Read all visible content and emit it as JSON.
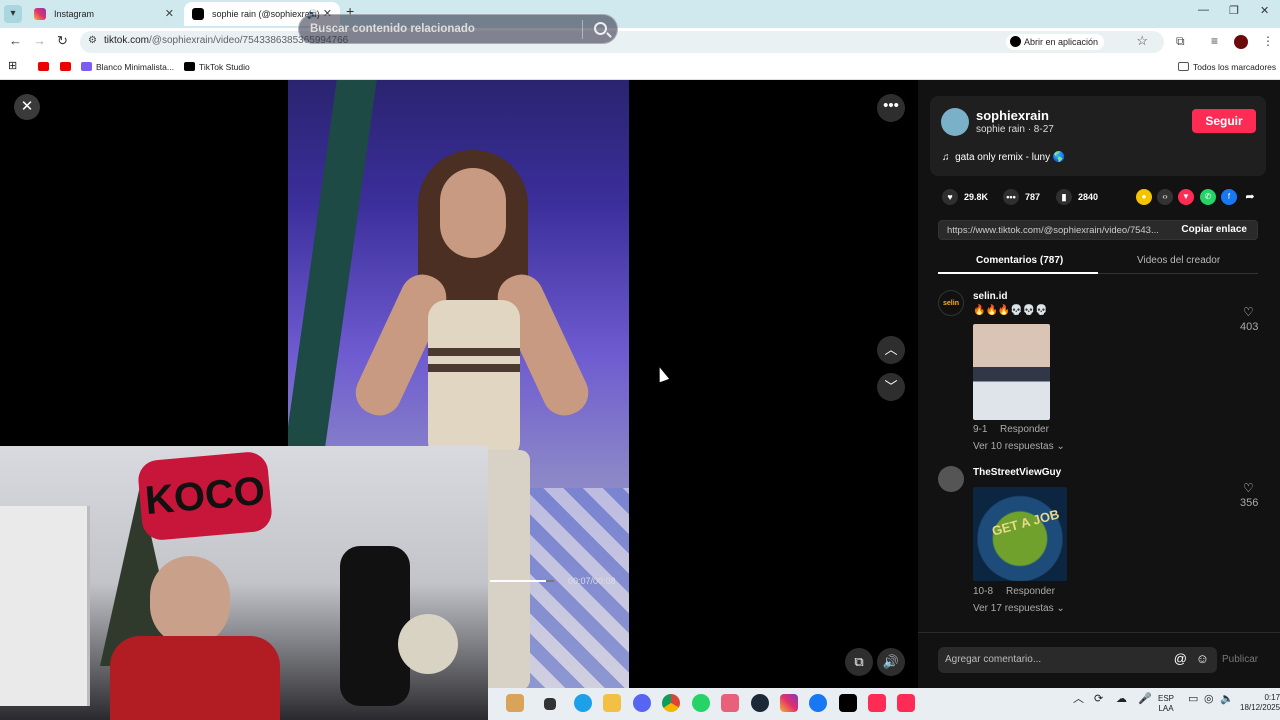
{
  "browser": {
    "tabs": [
      {
        "title": "Instagram",
        "active": false
      },
      {
        "title": "sophie rain (@sophiexrain)",
        "active": true
      }
    ],
    "url_host": "tiktok.com",
    "url_path": "/@sophiexrain/video/7543386385365994766",
    "open_in_app": "Abrir en aplicación",
    "bookmarks": [
      "Blanco Minimalista...",
      "TikTok Studio"
    ],
    "all_bookmarks": "Todos los marcadores"
  },
  "player": {
    "search_placeholder": "Buscar contenido relacionado",
    "time": "00:07/00:08",
    "progress": 0.875
  },
  "creator": {
    "username": "sophiexrain",
    "subtitle": "sophie rain · 8-27",
    "follow_label": "Seguir",
    "music": "gata only remix - luny 🌎"
  },
  "stats": {
    "likes": "29.8K",
    "comments": "787",
    "saves": "2840"
  },
  "share": {
    "link": "https://www.tiktok.com/@sophiexrain/video/7543...",
    "copy_label": "Copiar enlace"
  },
  "panel_tabs": {
    "comments": "Comentarios (787)",
    "creator_videos": "Videos del creador"
  },
  "comments": [
    {
      "user": "selin.id",
      "emoji": "🔥🔥🔥💀💀💀",
      "date": "9-1",
      "reply": "Responder",
      "more": "Ver 10 respuestas",
      "likes": "403"
    },
    {
      "user": "TheStreetViewGuy",
      "emoji": "",
      "date": "10-8",
      "reply": "Responder",
      "more": "Ver 17 respuestas",
      "likes": "356",
      "image_text": "GET A JOB"
    }
  ],
  "comment_box": {
    "placeholder": "Agregar comentario...",
    "publish": "Publicar"
  },
  "taskbar": {
    "lang": "ESP",
    "lang2": "LAA",
    "time": "0:17",
    "date": "18/12/2025"
  },
  "webcam": {
    "graffiti": "KOCO"
  },
  "colors": {
    "accent": "#fe2c55",
    "panel": "#121212"
  }
}
